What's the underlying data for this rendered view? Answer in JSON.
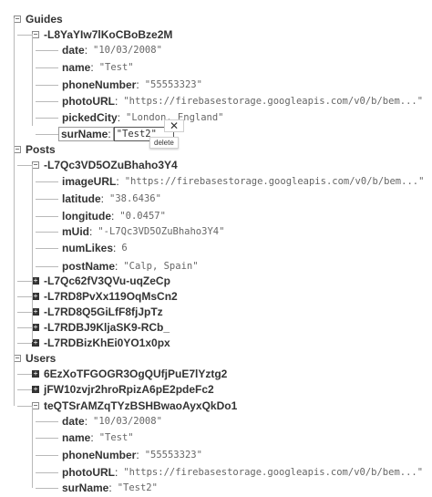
{
  "tree": [
    {
      "depth": 0,
      "key": "Guides",
      "state": "expanded"
    },
    {
      "depth": 1,
      "key": "-L8YaYIw7lKoCBoBze2M",
      "state": "expanded"
    },
    {
      "depth": 2,
      "key": "date",
      "value": "\"10/03/2008\""
    },
    {
      "depth": 2,
      "key": "name",
      "value": "\"Test\""
    },
    {
      "depth": 2,
      "key": "phoneNumber",
      "value": "\"55553323\""
    },
    {
      "depth": 2,
      "key": "photoURL",
      "value": "\"https://firebasestorage.googleapis.com/v0/b/bem...\""
    },
    {
      "depth": 2,
      "key": "pickedCity",
      "value": "\"London, England\""
    },
    {
      "depth": 2,
      "key": "surName",
      "editing": true,
      "value": "\"Test2\""
    },
    {
      "depth": 0,
      "key": "Posts",
      "state": "expanded"
    },
    {
      "depth": 1,
      "key": "-L7Qc3VD5OZuBhaho3Y4",
      "state": "expanded"
    },
    {
      "depth": 2,
      "key": "imageURL",
      "value": "\"https://firebasestorage.googleapis.com/v0/b/bem...\""
    },
    {
      "depth": 2,
      "key": "latitude",
      "value": "\"38.6436\""
    },
    {
      "depth": 2,
      "key": "longitude",
      "value": "\"0.0457\""
    },
    {
      "depth": 2,
      "key": "mUid",
      "value": "\"-L7Qc3VD5OZuBhaho3Y4\""
    },
    {
      "depth": 2,
      "key": "numLikes",
      "value": "6"
    },
    {
      "depth": 2,
      "key": "postName",
      "value": "\"Calp, Spain\""
    },
    {
      "depth": 1,
      "key": "-L7Qc62fV3QVu-uqZeCp",
      "state": "collapsed"
    },
    {
      "depth": 1,
      "key": "-L7RD8PvXx119OqMsCn2",
      "state": "collapsed"
    },
    {
      "depth": 1,
      "key": "-L7RD8Q5GiLfF8fjJpTz",
      "state": "collapsed"
    },
    {
      "depth": 1,
      "key": "-L7RDBJ9KljaSK9-RCb_",
      "state": "collapsed"
    },
    {
      "depth": 1,
      "key": "-L7RDBizKhEi0YO1x0px",
      "state": "collapsed"
    },
    {
      "depth": 0,
      "key": "Users",
      "state": "expanded"
    },
    {
      "depth": 1,
      "key": "6EzXoTFGOGR3OgQUfjPuE7lYztg2",
      "state": "collapsed"
    },
    {
      "depth": 1,
      "key": "jFW10zvjr2hroRpizA6pE2pdeFc2",
      "state": "collapsed"
    },
    {
      "depth": 1,
      "key": "teQTSrAMZqTYzBSHBwaoAyxQkDo1",
      "state": "expanded"
    },
    {
      "depth": 2,
      "key": "date",
      "value": "\"10/03/2008\""
    },
    {
      "depth": 2,
      "key": "name",
      "value": "\"Test\""
    },
    {
      "depth": 2,
      "key": "phoneNumber",
      "value": "\"55553323\""
    },
    {
      "depth": 2,
      "key": "photoURL",
      "value": "\"https://firebasestorage.googleapis.com/v0/b/bem...\""
    },
    {
      "depth": 2,
      "key": "surName",
      "value": "\"Test2\""
    }
  ],
  "edit": {
    "key_label": "surName",
    "input_value": "\"Test2\"",
    "delete_symbol": "✕",
    "tooltip": "delete"
  }
}
